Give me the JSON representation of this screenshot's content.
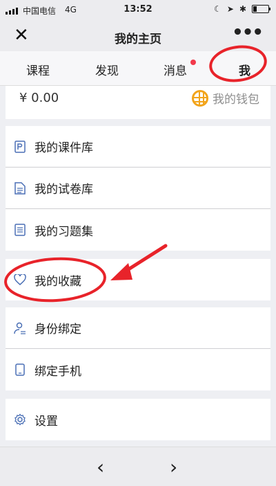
{
  "status_bar": {
    "carrier": "中国电信",
    "network": "4G",
    "time": "13:52"
  },
  "nav": {
    "close_glyph": "✕",
    "title": "我的主页",
    "more_glyph": "•••"
  },
  "tabs": [
    {
      "label": "课程"
    },
    {
      "label": "发现"
    },
    {
      "label": "消息",
      "has_dot": true
    },
    {
      "label": "我",
      "active": true
    }
  ],
  "wallet": {
    "balance": "¥ 0.00",
    "link_label": "我的钱包",
    "icon": "globe-icon"
  },
  "menu_groups": [
    {
      "items": [
        {
          "label": "我的课件库",
          "icon": "courseware-icon"
        },
        {
          "label": "我的试卷库",
          "icon": "document-icon"
        },
        {
          "label": "我的习题集",
          "icon": "list-icon"
        }
      ]
    },
    {
      "items": [
        {
          "label": "我的收藏",
          "icon": "heart-icon"
        }
      ]
    },
    {
      "items": [
        {
          "label": "身份绑定",
          "icon": "user-bind-icon"
        },
        {
          "label": "绑定手机",
          "icon": "phone-icon"
        }
      ]
    },
    {
      "items": [
        {
          "label": "设置",
          "icon": "gear-icon"
        }
      ]
    }
  ],
  "bottom_bar": {
    "back_glyph": "‹",
    "forward_glyph": "›"
  },
  "colors": {
    "accent_blue": "#4a6fb5",
    "annotation_red": "#e8232a",
    "badge_red": "#f2394b",
    "wallet_orange": "#f2a41b"
  }
}
